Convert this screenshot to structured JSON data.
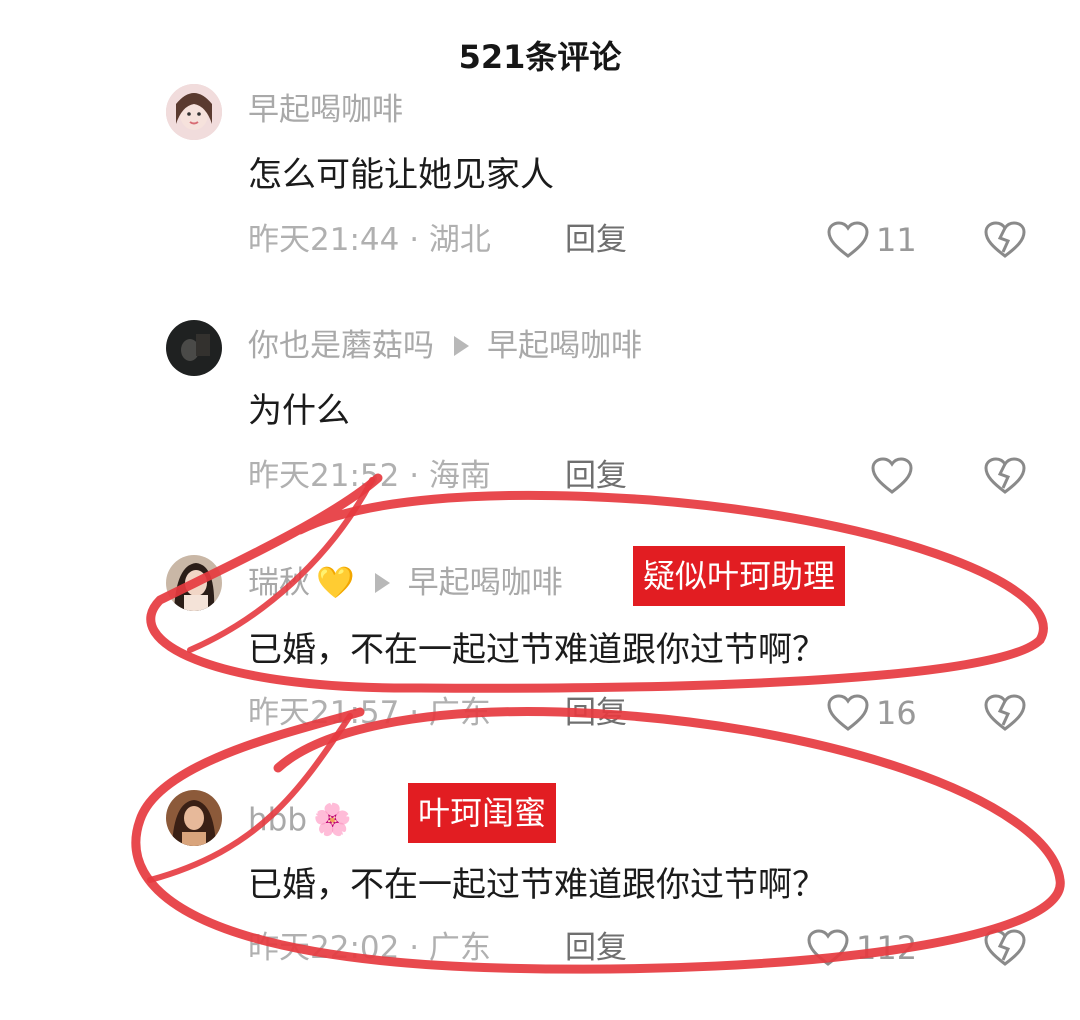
{
  "header": {
    "title": "521条评论"
  },
  "comments": [
    {
      "user": "早起喝咖啡",
      "reply_to": "",
      "text": "怎么可能让她见家人",
      "time": "昨天21:44",
      "location": "湖北",
      "reply_label": "回复",
      "likes": "11",
      "avatar_color": "#e9c9c9"
    },
    {
      "user": "你也是蘑菇吗",
      "reply_to": "早起喝咖啡",
      "text": "为什么",
      "time": "昨天21:52",
      "location": "海南",
      "reply_label": "回复",
      "likes": "",
      "avatar_color": "#2a2a2a"
    },
    {
      "user": "瑞秋",
      "reply_to": "早起喝咖啡",
      "text": "已婚，不在一起过节难道跟你过节啊？",
      "time": "昨天21:57",
      "location": "广东",
      "reply_label": "回复",
      "likes": "16",
      "avatar_color": "#6b5b52",
      "emoji": "💛"
    },
    {
      "user": "hbb",
      "reply_to": "",
      "text": "已婚，不在一起过节难道跟你过节啊？",
      "time": "昨天22:02",
      "location": "广东",
      "reply_label": "回复",
      "likes": "112",
      "avatar_color": "#b88a4a",
      "emoji": "🌸"
    }
  ],
  "annotations": {
    "tag1": "疑似叶珂助理",
    "tag2": "叶珂闺蜜",
    "color": "#e21d22"
  }
}
